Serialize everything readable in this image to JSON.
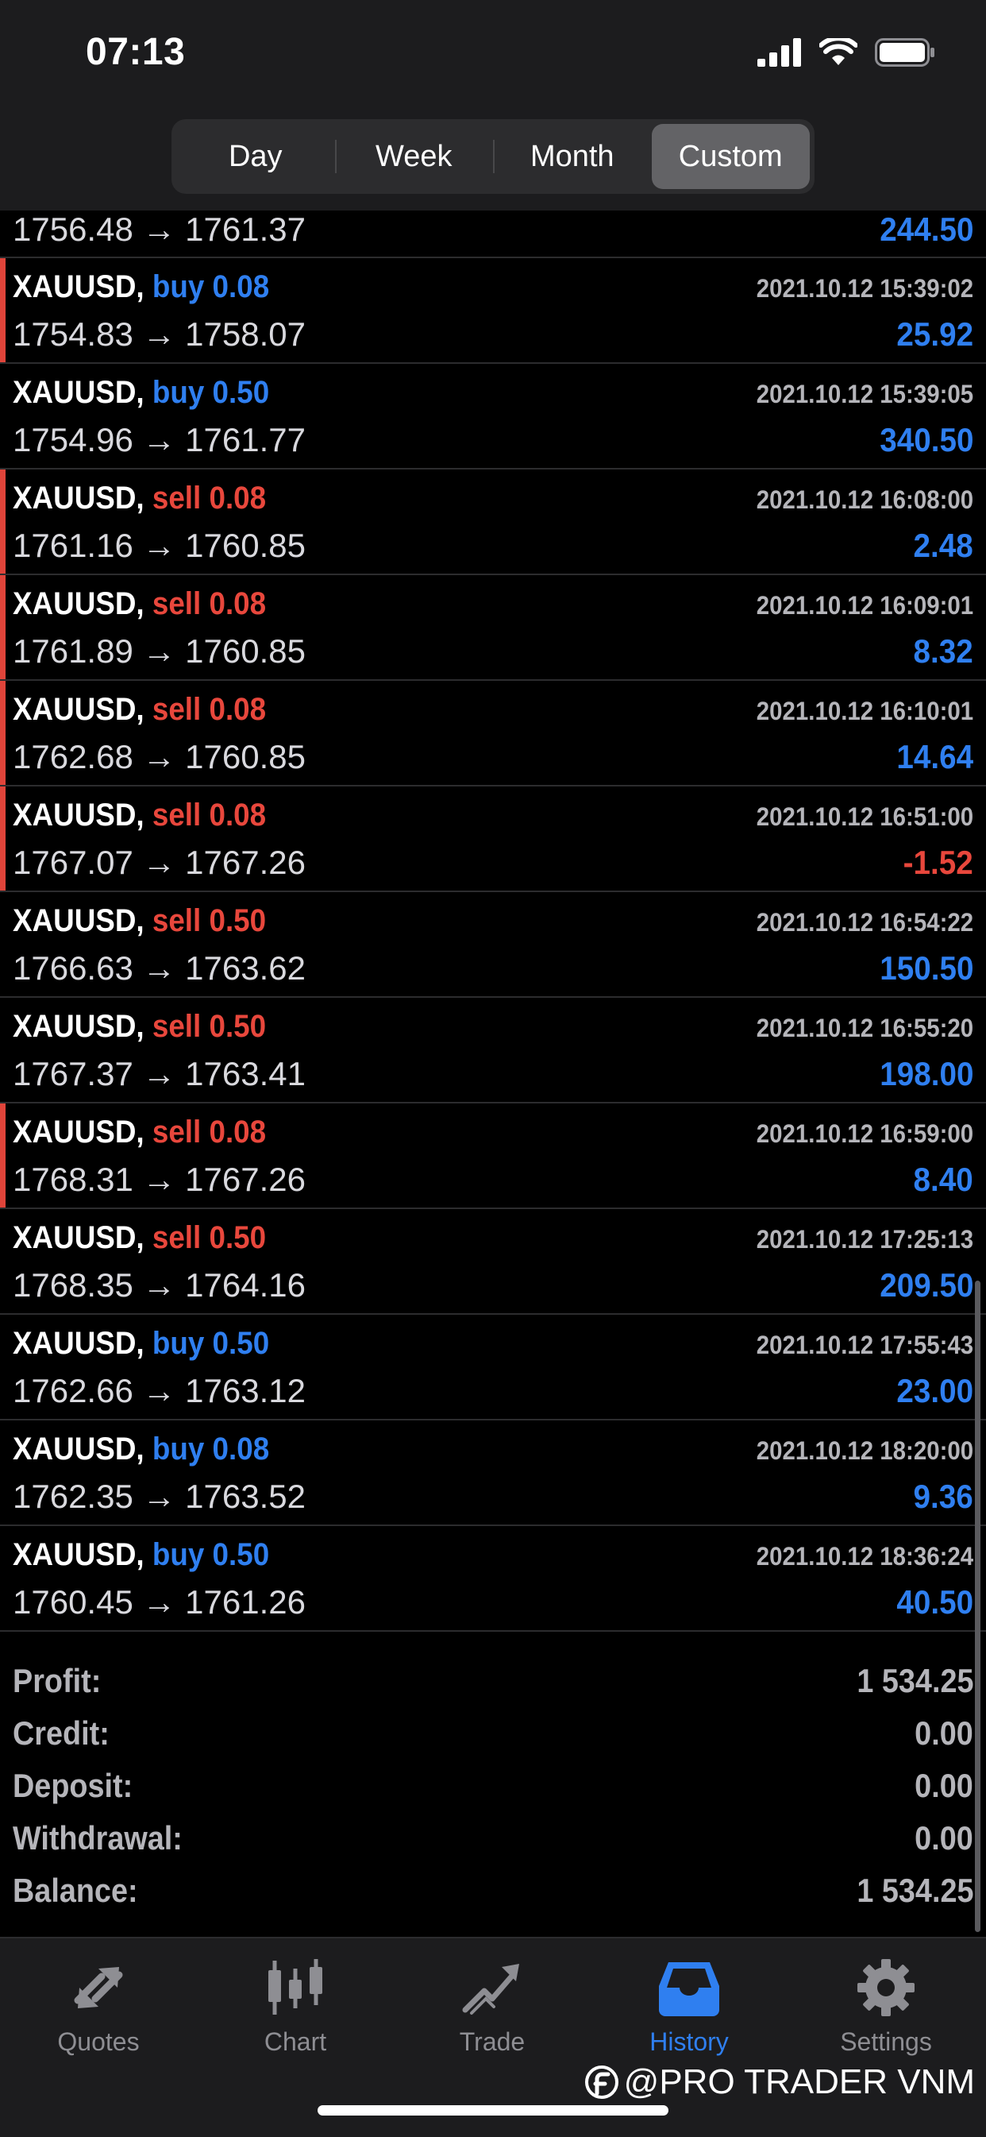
{
  "status_bar": {
    "time": "07:13"
  },
  "period_tabs": [
    {
      "label": "Day",
      "active": false
    },
    {
      "label": "Week",
      "active": false
    },
    {
      "label": "Month",
      "active": false
    },
    {
      "label": "Custom",
      "active": true
    }
  ],
  "partial_deal": {
    "prices": "1756.48 → 1761.37",
    "profit": "244.50"
  },
  "deals": [
    {
      "symbol": "XAUUSD,",
      "side": "buy",
      "volume": "0.08",
      "time": "2021.10.12 15:39:02",
      "prices": "1754.83 → 1758.07",
      "profit": "25.92",
      "marked": true
    },
    {
      "symbol": "XAUUSD,",
      "side": "buy",
      "volume": "0.50",
      "time": "2021.10.12 15:39:05",
      "prices": "1754.96 → 1761.77",
      "profit": "340.50",
      "marked": false
    },
    {
      "symbol": "XAUUSD,",
      "side": "sell",
      "volume": "0.08",
      "time": "2021.10.12 16:08:00",
      "prices": "1761.16 → 1760.85",
      "profit": "2.48",
      "marked": true
    },
    {
      "symbol": "XAUUSD,",
      "side": "sell",
      "volume": "0.08",
      "time": "2021.10.12 16:09:01",
      "prices": "1761.89 → 1760.85",
      "profit": "8.32",
      "marked": true
    },
    {
      "symbol": "XAUUSD,",
      "side": "sell",
      "volume": "0.08",
      "time": "2021.10.12 16:10:01",
      "prices": "1762.68 → 1760.85",
      "profit": "14.64",
      "marked": true
    },
    {
      "symbol": "XAUUSD,",
      "side": "sell",
      "volume": "0.08",
      "time": "2021.10.12 16:51:00",
      "prices": "1767.07 → 1767.26",
      "profit": "-1.52",
      "marked": true
    },
    {
      "symbol": "XAUUSD,",
      "side": "sell",
      "volume": "0.50",
      "time": "2021.10.12 16:54:22",
      "prices": "1766.63 → 1763.62",
      "profit": "150.50",
      "marked": false
    },
    {
      "symbol": "XAUUSD,",
      "side": "sell",
      "volume": "0.50",
      "time": "2021.10.12 16:55:20",
      "prices": "1767.37 → 1763.41",
      "profit": "198.00",
      "marked": false
    },
    {
      "symbol": "XAUUSD,",
      "side": "sell",
      "volume": "0.08",
      "time": "2021.10.12 16:59:00",
      "prices": "1768.31 → 1767.26",
      "profit": "8.40",
      "marked": true
    },
    {
      "symbol": "XAUUSD,",
      "side": "sell",
      "volume": "0.50",
      "time": "2021.10.12 17:25:13",
      "prices": "1768.35 → 1764.16",
      "profit": "209.50",
      "marked": false
    },
    {
      "symbol": "XAUUSD,",
      "side": "buy",
      "volume": "0.50",
      "time": "2021.10.12 17:55:43",
      "prices": "1762.66 → 1763.12",
      "profit": "23.00",
      "marked": false
    },
    {
      "symbol": "XAUUSD,",
      "side": "buy",
      "volume": "0.08",
      "time": "2021.10.12 18:20:00",
      "prices": "1762.35 → 1763.52",
      "profit": "9.36",
      "marked": false
    },
    {
      "symbol": "XAUUSD,",
      "side": "buy",
      "volume": "0.50",
      "time": "2021.10.12 18:36:24",
      "prices": "1760.45 → 1761.26",
      "profit": "40.50",
      "marked": false
    }
  ],
  "summary": [
    {
      "label": "Profit:",
      "value": "1 534.25"
    },
    {
      "label": "Credit:",
      "value": "0.00"
    },
    {
      "label": "Deposit:",
      "value": "0.00"
    },
    {
      "label": "Withdrawal:",
      "value": "0.00"
    },
    {
      "label": "Balance:",
      "value": "1 534.25"
    }
  ],
  "tab_bar": [
    {
      "label": "Quotes",
      "icon": "quotes-icon",
      "active": false
    },
    {
      "label": "Chart",
      "icon": "chart-icon",
      "active": false
    },
    {
      "label": "Trade",
      "icon": "trade-icon",
      "active": false
    },
    {
      "label": "History",
      "icon": "history-icon",
      "active": true
    },
    {
      "label": "Settings",
      "icon": "settings-icon",
      "active": false
    }
  ],
  "watermark": "@PRO TRADER VNM",
  "colors": {
    "buy": "#2f7ff0",
    "sell": "#e8473c",
    "accent": "#2f7ff0",
    "background": "#000000"
  }
}
